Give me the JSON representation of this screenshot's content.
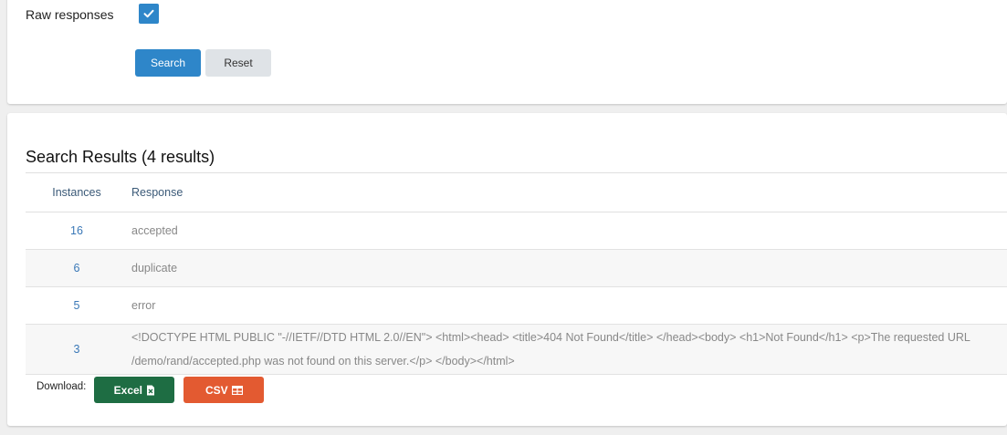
{
  "filter": {
    "raw_responses_label": "Raw responses",
    "raw_responses_checked": true,
    "search_label": "Search",
    "reset_label": "Reset"
  },
  "results": {
    "title": "Search Results (4 results)",
    "columns": [
      "Instances",
      "Response"
    ],
    "rows": [
      {
        "instances": "16",
        "response": "accepted"
      },
      {
        "instances": "6",
        "response": "duplicate"
      },
      {
        "instances": "5",
        "response": "error"
      },
      {
        "instances": "3",
        "response": "<!DOCTYPE HTML PUBLIC \"-//IETF//DTD HTML 2.0//EN\"> <html><head> <title>404 Not Found</title> </head><body> <h1>Not Found</h1> <p>The requested URL /demo/rand/accepted.php was not found on this server.</p> </body></html>"
      }
    ]
  },
  "download": {
    "label": "Download:",
    "excel_label": "Excel",
    "csv_label": "CSV",
    "excel_icon": "excel-file-icon",
    "csv_icon": "table-grid-icon"
  },
  "colors": {
    "primary": "#2e86c9",
    "excel": "#1e6d43",
    "csv": "#e35a31"
  }
}
